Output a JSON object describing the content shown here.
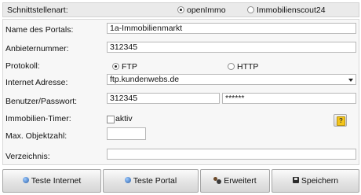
{
  "header": {
    "label": "Schnittstellenart:",
    "options": [
      {
        "label": "openImmo",
        "selected": true
      },
      {
        "label": "Immobilienscout24",
        "selected": false
      }
    ]
  },
  "form": {
    "portal_name": {
      "label": "Name des Portals:",
      "value": "1a-Immobilienmarkt"
    },
    "provider_number": {
      "label": "Anbieternummer:",
      "value": "312345"
    },
    "protocol": {
      "label": "Protokoll:",
      "options": [
        {
          "label": "FTP",
          "selected": true
        },
        {
          "label": "HTTP",
          "selected": false
        }
      ]
    },
    "internet_address": {
      "label": "Internet Adresse:",
      "value": "ftp.kundenwebs.de"
    },
    "credentials": {
      "label": "Benutzer/Passwort:",
      "user": "312345",
      "password": "******"
    },
    "timer": {
      "label": "Immobilien-Timer:",
      "checkbox_label": "aktiv",
      "checked": false
    },
    "max_objects": {
      "label": "Max. Objektzahl:",
      "value": ""
    },
    "directory": {
      "label": "Verzeichnis:",
      "value": ""
    }
  },
  "help_icon": "help-question-icon",
  "buttons": {
    "test_internet": {
      "label": "Teste Internet",
      "icon": "globe-icon"
    },
    "test_portal": {
      "label": "Teste Portal",
      "icon": "globe-icon"
    },
    "advanced": {
      "label": "Erweitert",
      "icon": "users-icon"
    },
    "save": {
      "label": "Speichern",
      "icon": "save-disk-icon"
    }
  },
  "colors": {
    "panel_bg": "#f7f7f7",
    "header_bg": "#eaeaea",
    "button_bg": "#e4e4e4",
    "help_yellow": "#f3c51b"
  }
}
